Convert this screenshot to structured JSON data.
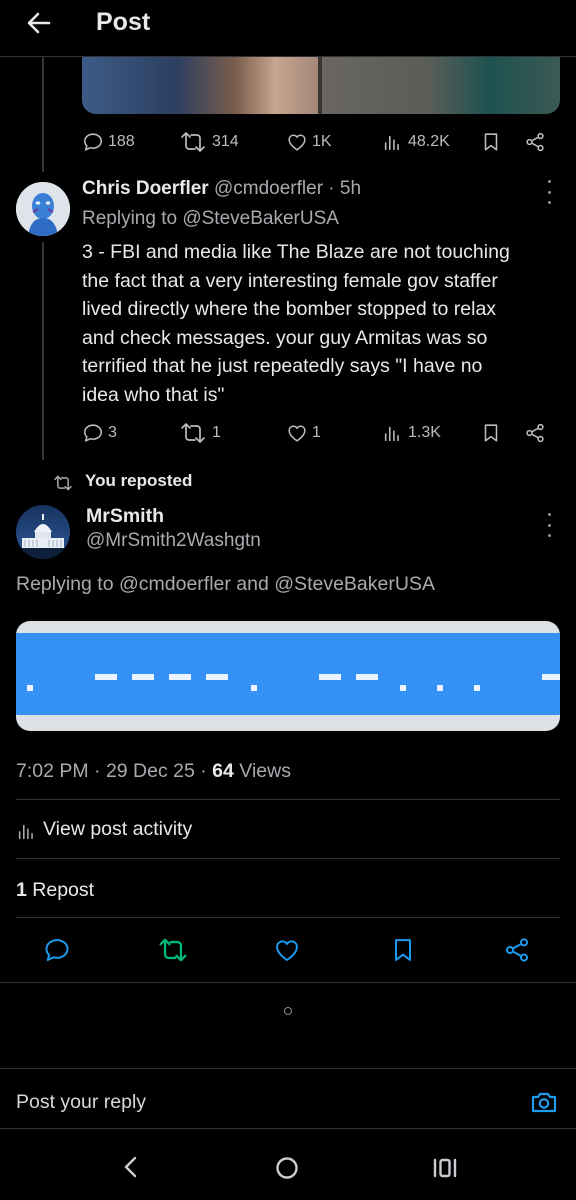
{
  "header": {
    "title": "Post"
  },
  "parent_post": {
    "actions": {
      "replies": "188",
      "reposts": "314",
      "likes": "1K",
      "views": "48.2K"
    }
  },
  "reply_post": {
    "display_name": "Chris Doerfler",
    "handle_time": "@cmdoerfler · 5h",
    "replying_prefix": "Replying to ",
    "replying_to": "@SteveBakerUSA",
    "body_lines": [
      "3 - FBI and media like The Blaze are not touching",
      "the fact that a very interesting female gov staffer",
      "lived directly where the bomber stopped to relax",
      "and check messages. your guy Armitas was so",
      "terrified that he just repeatedly says \"I have no",
      "idea who that is\""
    ],
    "actions": {
      "replies": "3",
      "reposts": "1",
      "likes": "1",
      "views": "1.3K"
    }
  },
  "repost_label": "You reposted",
  "main_post": {
    "display_name": "MrSmith",
    "handle": "@MrSmith2Washgtn",
    "replying_prefix": "Replying to ",
    "mention_1": "@cmdoerfler",
    "replying_and": " and ",
    "mention_2": "@SteveBakerUSA",
    "timestamp": "7:02 PM · 29 Dec 25 · ",
    "views_count": "64",
    "views_label": " Views",
    "view_activity": "View post activity",
    "repost_count": "1",
    "repost_label": " Repost"
  },
  "reply_box": {
    "placeholder": "Post your reply"
  },
  "colors": {
    "accent": "#1d9bf0",
    "repost_green": "#00ba7c",
    "image_blue": "#3392f3"
  }
}
